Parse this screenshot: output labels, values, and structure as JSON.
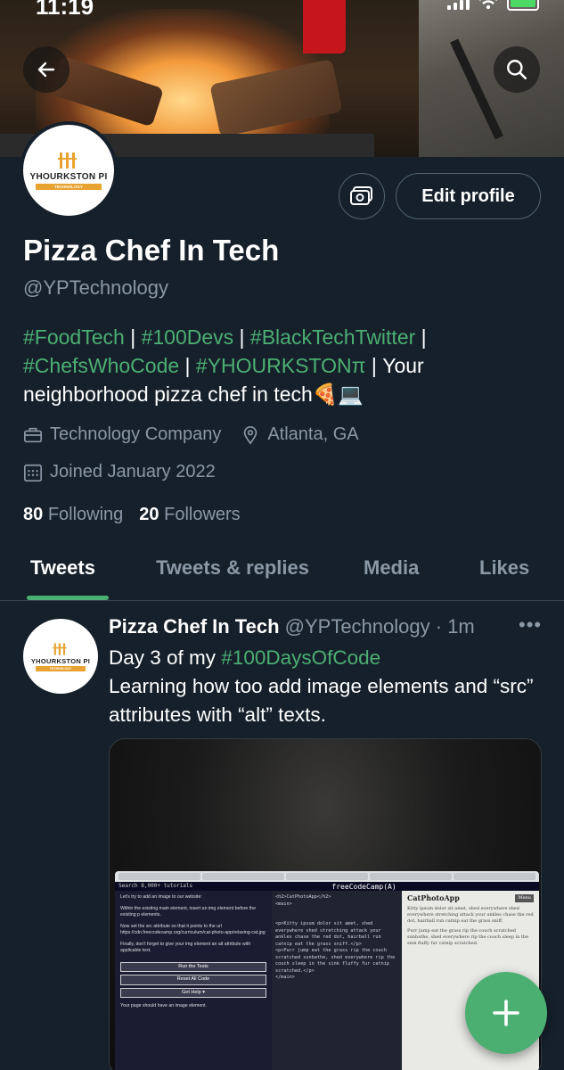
{
  "status_bar": {
    "time": "11:19"
  },
  "header": {
    "back_icon": "arrow-left-icon",
    "search_icon": "search-icon"
  },
  "profile": {
    "avatar_logo": {
      "line1": "YHOURKSTON PI",
      "line2": "TECHNOLOGY"
    },
    "display_name": "Pizza Chef In Tech",
    "handle": "@YPTechnology",
    "edit_profile_label": "Edit profile",
    "bio": {
      "tags_line1": [
        "#FoodTech",
        "#100Devs",
        "#BlackTechTwitter"
      ],
      "tags_line2": [
        "#ChefsWhoCode",
        "#YHOURKSTONπ"
      ],
      "separator": " | ",
      "text": "Your neighborhood pizza chef in tech🍕💻"
    },
    "category": "Technology Company",
    "location": "Atlanta, GA",
    "joined": "Joined January 2022",
    "following_count": "80",
    "following_label": "Following",
    "followers_count": "20",
    "followers_label": "Followers"
  },
  "tabs": [
    {
      "label": "Tweets",
      "active": true
    },
    {
      "label": "Tweets & replies",
      "active": false
    },
    {
      "label": "Media",
      "active": false
    },
    {
      "label": "Likes",
      "active": false
    }
  ],
  "tweet": {
    "author_name": "Pizza Chef In Tech",
    "author_handle": "@YPTechnology",
    "separator": " · ",
    "time": "1m",
    "more": "•••",
    "text_prefix": "Day 3 of my ",
    "hashtag": "#100DaysOfCode",
    "text_body": "Learning how too add image elements and “src” attributes with “alt” texts.",
    "media": {
      "app_title": "freeCodeCamp(A)",
      "search": "Search 8,000+ tutorials",
      "instructions": [
        "Let's try to add an image to our website:",
        "Within the existing main element, insert an img element before the existing p elements.",
        "Now set the src attribute so that it points to the url https://cdn.freecodecamp.org/curriculum/cat-photo-app/relaxing-cat.jpg",
        "Finally, don't forget to give your img element an alt attribute with applicable text."
      ],
      "buttons": [
        "Run the Tests",
        "Reset All Code",
        "Get Help ▾"
      ],
      "hint": "Your page should have an image element.",
      "code_lines": [
        "<h2>CatPhotoApp</h2>",
        "<main>",
        "",
        "",
        "<p>Kitty ipsum dolor sit amet, shed everywhere shed stretching attack your ankles chase the red dot, hairball run catnip eat the grass sniff.</p>",
        "<p>Purr jump eat the grass rip the couch scratched sunbathe, shed everywhere rip the couch sleep in the sink fluffy fur catnip scratched.</p>",
        "</main>"
      ],
      "preview_title": "CatPhotoApp",
      "preview_menu": "Menu",
      "preview_p1": "Kitty ipsum dolor sit amet, shed everywhere shed everywhere stretching attack your ankles chase the red dot, hairball run catnip eat the grass sniff.",
      "preview_p2": "Purr jump eat the grass rip the couch scratched sunbathe, shed everywhere rip the couch sleep in the sink fluffy fur catnip scratched."
    }
  },
  "fab": {
    "icon": "plus-icon"
  },
  "colors": {
    "background": "#15202b",
    "accent": "#4caf72",
    "muted": "#8b98a5",
    "divider": "#38444d"
  }
}
